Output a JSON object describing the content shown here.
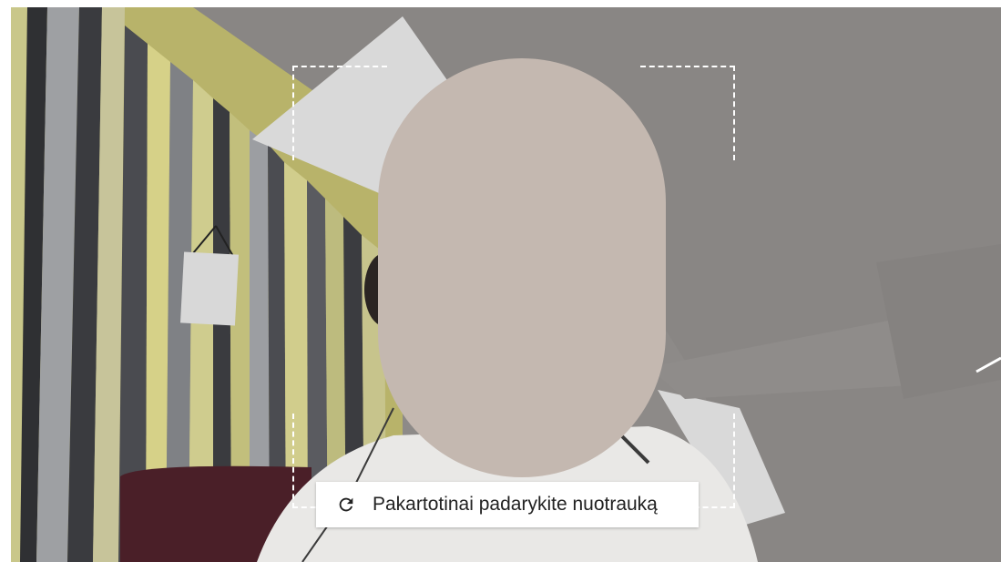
{
  "retake_button": {
    "label": "Pakartotinai padarykite nuotrauką",
    "icon": "refresh-icon"
  },
  "colors": {
    "face_mask": "#c4b8b0",
    "guide_lines": "#ffffff",
    "button_background": "#ffffff",
    "button_text": "#222222"
  }
}
